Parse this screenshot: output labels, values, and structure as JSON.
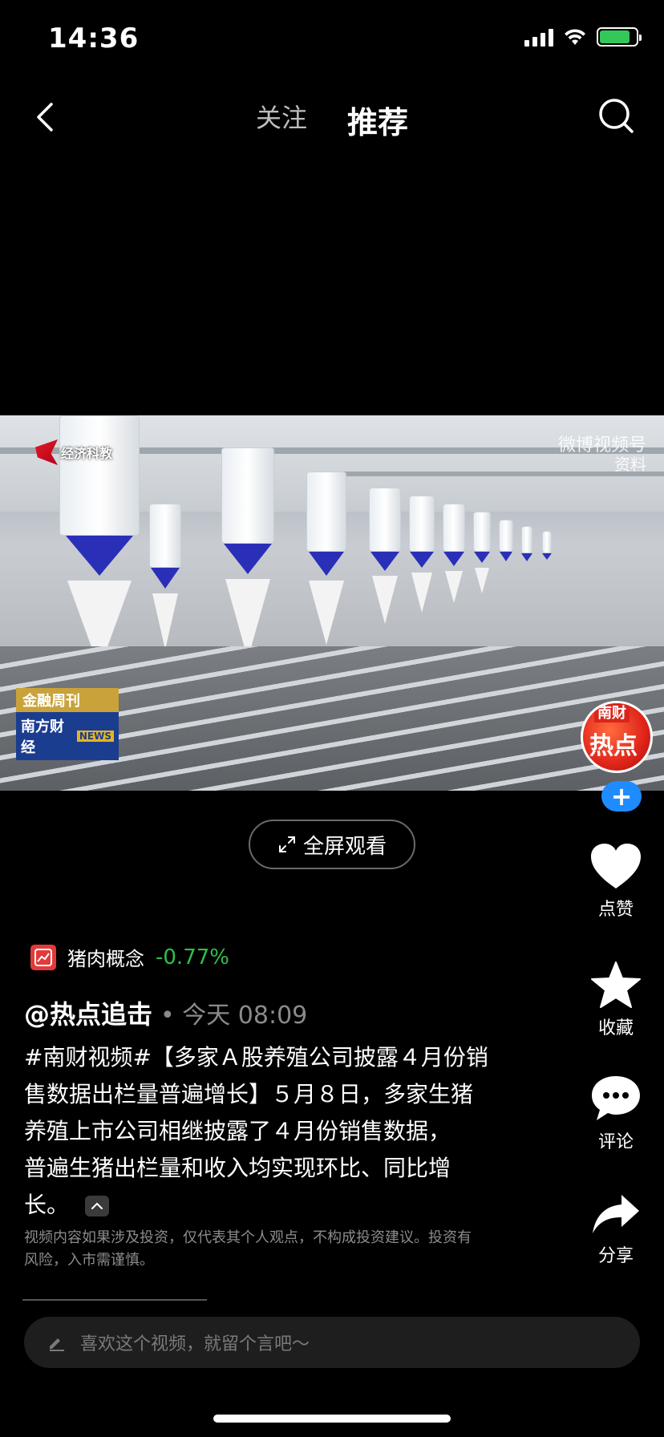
{
  "status_bar": {
    "time": "14:36"
  },
  "nav": {
    "tabs": [
      {
        "label": "关注",
        "active": false
      },
      {
        "label": "推荐",
        "active": true
      }
    ]
  },
  "video": {
    "channel_logo": "经济科教",
    "watermark": "微博视频号",
    "watermark_sub": "资料",
    "badge_top": "金融周刊",
    "badge_bottom": "南方财经",
    "badge_en": "NEWS"
  },
  "avatar": {
    "tag": "南财",
    "text": "热点"
  },
  "fullscreen": {
    "label": "全屏观看"
  },
  "actions": {
    "like": "点赞",
    "favorite": "收藏",
    "comment": "评论",
    "share": "分享"
  },
  "stock": {
    "name": "猪肉概念",
    "change": "-0.77%",
    "change_color": "#2fbf4a"
  },
  "post": {
    "author": "@热点追击",
    "time": "• 今天 08:09",
    "caption_lines": [
      "#南财视频#【多家Ａ股养殖公司披露４月份销",
      "售数据出栏量普遍增长】５月８日，多家生猪",
      "养殖上市公司相继披露了４月份销售数据，",
      "普遍生猪出栏量和收入均实现环比、同比增",
      "长。"
    ],
    "disclaimer_lines": [
      "视频内容如果涉及投资，仅代表其个人观点，不构成投资建议。投资有",
      "风险，入市需谨慎。"
    ]
  },
  "comment_bar": {
    "placeholder": "喜欢这个视频，就留个言吧～"
  },
  "icons": [
    "back-icon",
    "search-icon",
    "fullscreen-icon",
    "heart-icon",
    "star-icon",
    "comment-icon",
    "share-icon",
    "stock-chart-icon",
    "pencil-icon",
    "chevron-up-icon",
    "plus-icon"
  ]
}
